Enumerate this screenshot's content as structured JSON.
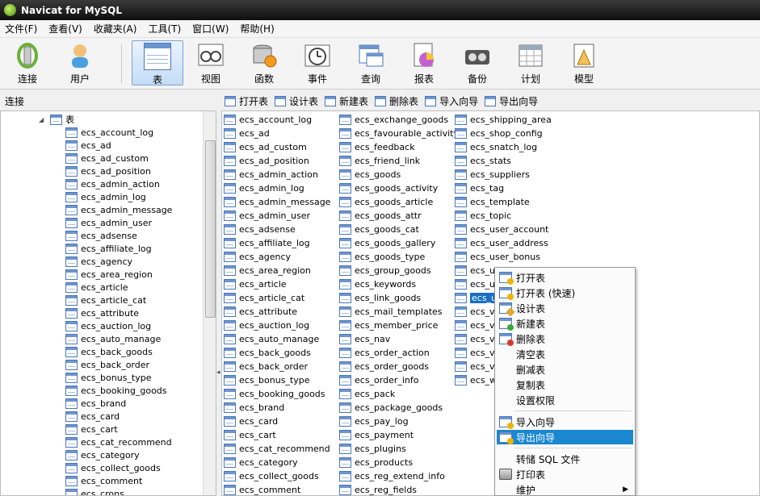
{
  "window": {
    "title": "Navicat for MySQL"
  },
  "menu": [
    "文件(F)",
    "查看(V)",
    "收藏夹(A)",
    "工具(T)",
    "窗口(W)",
    "帮助(H)"
  ],
  "toolbar": [
    {
      "label": "连接",
      "icon": "connection-icon"
    },
    {
      "label": "用户",
      "icon": "user-icon"
    },
    {
      "label": "表",
      "icon": "table-icon",
      "active": true
    },
    {
      "label": "视图",
      "icon": "view-icon"
    },
    {
      "label": "函数",
      "icon": "function-icon"
    },
    {
      "label": "事件",
      "icon": "event-icon"
    },
    {
      "label": "查询",
      "icon": "query-icon"
    },
    {
      "label": "报表",
      "icon": "report-icon"
    },
    {
      "label": "备份",
      "icon": "backup-icon"
    },
    {
      "label": "计划",
      "icon": "schedule-icon"
    },
    {
      "label": "模型",
      "icon": "model-icon"
    }
  ],
  "connection_panel": {
    "label": "连接"
  },
  "object_toolbar": [
    "打开表",
    "设计表",
    "新建表",
    "删除表",
    "导入向导",
    "导出向导"
  ],
  "tree": {
    "root_label": "表",
    "items": [
      "ecs_account_log",
      "ecs_ad",
      "ecs_ad_custom",
      "ecs_ad_position",
      "ecs_admin_action",
      "ecs_admin_log",
      "ecs_admin_message",
      "ecs_admin_user",
      "ecs_adsense",
      "ecs_affiliate_log",
      "ecs_agency",
      "ecs_area_region",
      "ecs_article",
      "ecs_article_cat",
      "ecs_attribute",
      "ecs_auction_log",
      "ecs_auto_manage",
      "ecs_back_goods",
      "ecs_back_order",
      "ecs_bonus_type",
      "ecs_booking_goods",
      "ecs_brand",
      "ecs_card",
      "ecs_cart",
      "ecs_cat_recommend",
      "ecs_category",
      "ecs_collect_goods",
      "ecs_comment",
      "ecs_crons"
    ]
  },
  "tables": {
    "col1": [
      "ecs_account_log",
      "ecs_ad",
      "ecs_ad_custom",
      "ecs_ad_position",
      "ecs_admin_action",
      "ecs_admin_log",
      "ecs_admin_message",
      "ecs_admin_user",
      "ecs_adsense",
      "ecs_affiliate_log",
      "ecs_agency",
      "ecs_area_region",
      "ecs_article",
      "ecs_article_cat",
      "ecs_attribute",
      "ecs_auction_log",
      "ecs_auto_manage",
      "ecs_back_goods",
      "ecs_back_order",
      "ecs_bonus_type",
      "ecs_booking_goods",
      "ecs_brand",
      "ecs_card",
      "ecs_cart",
      "ecs_cat_recommend",
      "ecs_category",
      "ecs_collect_goods",
      "ecs_comment"
    ],
    "col2": [
      "ecs_exchange_goods",
      "ecs_favourable_activity",
      "ecs_feedback",
      "ecs_friend_link",
      "ecs_goods",
      "ecs_goods_activity",
      "ecs_goods_article",
      "ecs_goods_attr",
      "ecs_goods_cat",
      "ecs_goods_gallery",
      "ecs_goods_type",
      "ecs_group_goods",
      "ecs_keywords",
      "ecs_link_goods",
      "ecs_mail_templates",
      "ecs_member_price",
      "ecs_nav",
      "ecs_order_action",
      "ecs_order_goods",
      "ecs_order_info",
      "ecs_pack",
      "ecs_package_goods",
      "ecs_pay_log",
      "ecs_payment",
      "ecs_plugins",
      "ecs_products",
      "ecs_reg_extend_info",
      "ecs_reg_fields"
    ],
    "col3": [
      "ecs_shipping_area",
      "ecs_shop_config",
      "ecs_snatch_log",
      "ecs_stats",
      "ecs_suppliers",
      "ecs_tag",
      "ecs_template",
      "ecs_topic",
      "ecs_user_account",
      "ecs_user_address",
      "ecs_user_bonus",
      "ecs_us",
      "ecs_us",
      "ecs_us",
      "ecs_vi",
      "ecs_vo",
      "ecs_vo",
      "ecs_vo",
      "ecs_vo",
      "ecs_wi"
    ],
    "selected_index_col3": 13
  },
  "context_menu": {
    "items": [
      {
        "label": "打开表",
        "icon": "open-table-icon"
      },
      {
        "label": "打开表 (快速)",
        "icon": "open-table-quick-icon"
      },
      {
        "label": "设计表",
        "icon": "design-table-icon"
      },
      {
        "label": "新建表",
        "icon": "new-table-icon"
      },
      {
        "label": "删除表",
        "icon": "delete-table-icon"
      },
      {
        "label": "清空表"
      },
      {
        "label": "删减表"
      },
      {
        "label": "复制表"
      },
      {
        "label": "设置权限"
      },
      {
        "label": "导入向导",
        "icon": "import-wizard-icon"
      },
      {
        "label": "导出向导",
        "icon": "export-wizard-icon",
        "highlighted": true
      },
      {
        "label": "转储 SQL 文件"
      },
      {
        "label": "打印表",
        "icon": "printer-icon"
      },
      {
        "label": "维护",
        "submenu": true
      }
    ]
  },
  "colors": {
    "selection": "#1a6fc4",
    "menu_highlight": "#1a87d0",
    "title_bar": "#1a1a1a"
  }
}
